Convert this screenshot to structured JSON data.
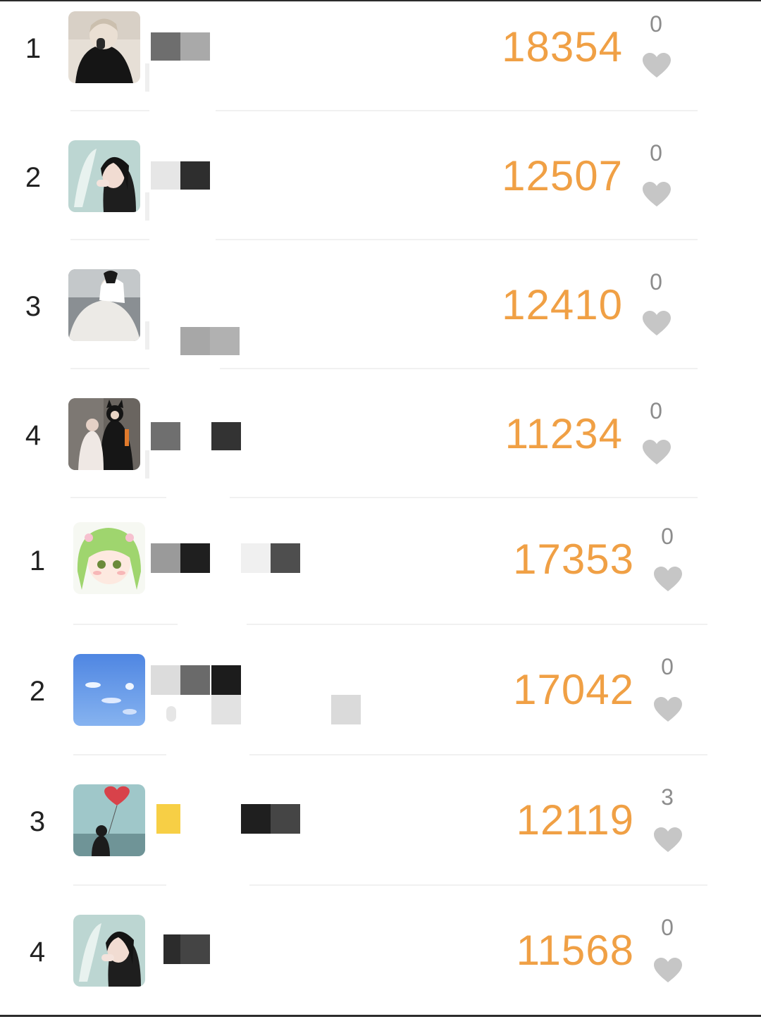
{
  "accent_color": "#f0a045",
  "like_icon": "heart-icon",
  "group_one": [
    {
      "rank": "1",
      "score": "18354",
      "likes": "0"
    },
    {
      "rank": "2",
      "score": "12507",
      "likes": "0"
    },
    {
      "rank": "3",
      "score": "12410",
      "likes": "0"
    },
    {
      "rank": "4",
      "score": "11234",
      "likes": "0"
    }
  ],
  "group_two": [
    {
      "rank": "1",
      "score": "17353",
      "likes": "0"
    },
    {
      "rank": "2",
      "score": "17042",
      "likes": "0"
    },
    {
      "rank": "3",
      "score": "12119",
      "likes": "3"
    },
    {
      "rank": "4",
      "score": "11568",
      "likes": "0"
    }
  ]
}
